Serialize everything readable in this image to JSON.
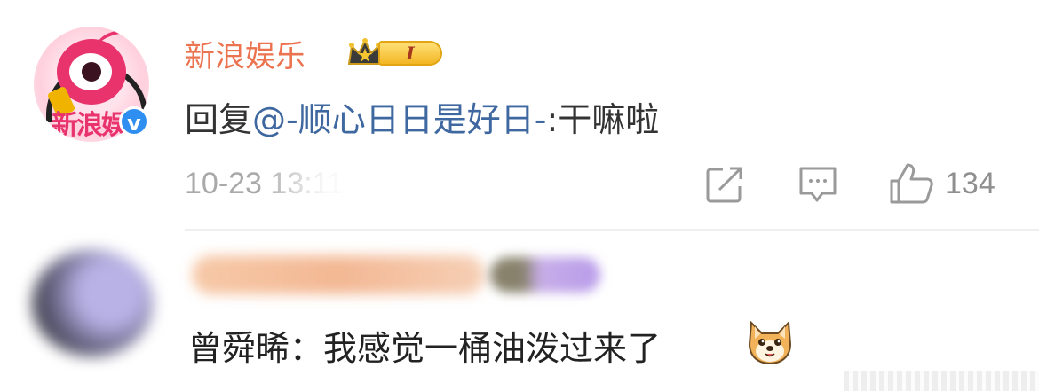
{
  "comment1": {
    "username": "新浪娱乐",
    "level_badge": "I",
    "avatar_text": "新浪娱",
    "verified_mark": "v",
    "reply_prefix": "回复",
    "mention": "@-顺心日日是好日-",
    "reply_text": ":干嘛啦",
    "timestamp": "10-23 13:11",
    "like_count": "134",
    "icons": [
      "share-icon",
      "comment-icon",
      "like-icon",
      "verified-icon",
      "crown-icon"
    ]
  },
  "comment2": {
    "text": "曾舜晞：我感觉一桶油泼过来了",
    "emoji": "dog-face-emoji"
  },
  "colors": {
    "username": "#eb7350",
    "mention": "#3f68a0",
    "meta": "#a9a9a9",
    "verified": "#2f8ff0",
    "brand": "#e8336c"
  }
}
